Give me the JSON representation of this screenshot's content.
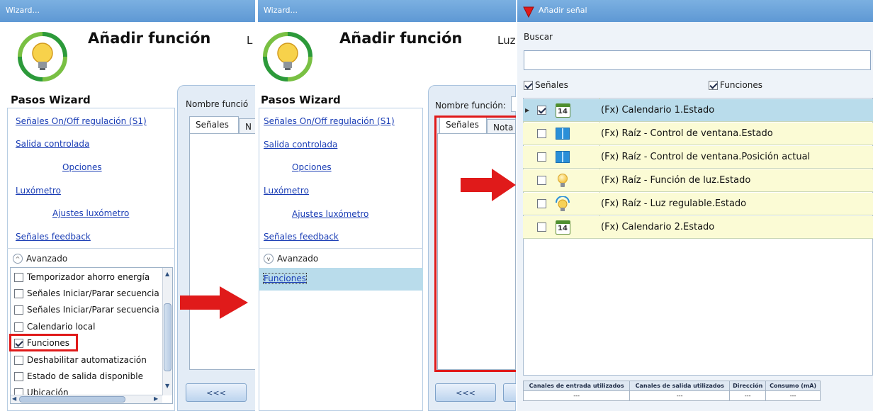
{
  "wizard_title": "Wizard...",
  "heading": "Añadir función",
  "heading_suffix_1": "L",
  "heading_suffix_2": "Luz",
  "steps_title": "Pasos Wizard",
  "steps": [
    {
      "label": "Señales On/Off regulación (S1)"
    },
    {
      "label": "Salida controlada"
    },
    {
      "label": "Opciones"
    },
    {
      "label": "Luxómetro"
    },
    {
      "label": "Ajustes luxómetro"
    },
    {
      "label": "Señales feedback"
    }
  ],
  "advanced_label": "Avanzado",
  "advanced_options": [
    {
      "label": "Temporizador ahorro energía",
      "checked": false
    },
    {
      "label": "Señales Iniciar/Parar secuencia",
      "checked": false
    },
    {
      "label": "Señales Iniciar/Parar secuencia",
      "checked": false
    },
    {
      "label": "Calendario local",
      "checked": false
    },
    {
      "label": "Funciones",
      "checked": true
    },
    {
      "label": "Deshabilitar automatización",
      "checked": false
    },
    {
      "label": "Estado de salida disponible",
      "checked": false
    },
    {
      "label": "Ubicación",
      "checked": false
    }
  ],
  "funciones_step": "Funciones",
  "function_name_label_1": "Nombre funció",
  "function_name_label_2": "Nombre función:",
  "tab_signals": "Señales",
  "tab_notes_1": "N",
  "tab_notes_2": "Nota",
  "back_button": "<<<",
  "dialog": {
    "title": "Añadir señal",
    "search_label": "Buscar",
    "search_value": "",
    "filter_signals": "Señales",
    "filter_functions": "Funciones",
    "rows": [
      {
        "label": "(Fx) Calendario 1.Estado",
        "icon": "calendar-icon",
        "checked": true,
        "calendar_day": "14",
        "selected": true
      },
      {
        "label": "(Fx) Raíz - Control de ventana.Estado",
        "icon": "window-icon",
        "checked": false
      },
      {
        "label": "(Fx) Raíz - Control de ventana.Posición actual",
        "icon": "window-icon",
        "checked": false
      },
      {
        "label": "(Fx) Raíz - Función de luz.Estado",
        "icon": "light-bulb-icon",
        "checked": false
      },
      {
        "label": "(Fx) Raíz - Luz regulable.Estado",
        "icon": "dimmable-light-icon",
        "checked": false
      },
      {
        "label": "(Fx) Calendario 2.Estado",
        "icon": "calendar-icon",
        "checked": false,
        "calendar_day": "14"
      }
    ],
    "status_headers": [
      "Canales de entrada utilizados",
      "Canales de salida utilizados",
      "Dirección",
      "Consumo (mA)"
    ],
    "status_values": [
      "---",
      "---",
      "---",
      "---"
    ]
  },
  "colors": {
    "titlebar": "#6aa3db",
    "highlight_red": "#e01a1a",
    "row_yellow": "#fbfbd5",
    "row_selected": "#b9dceb",
    "link": "#1a3db5"
  }
}
